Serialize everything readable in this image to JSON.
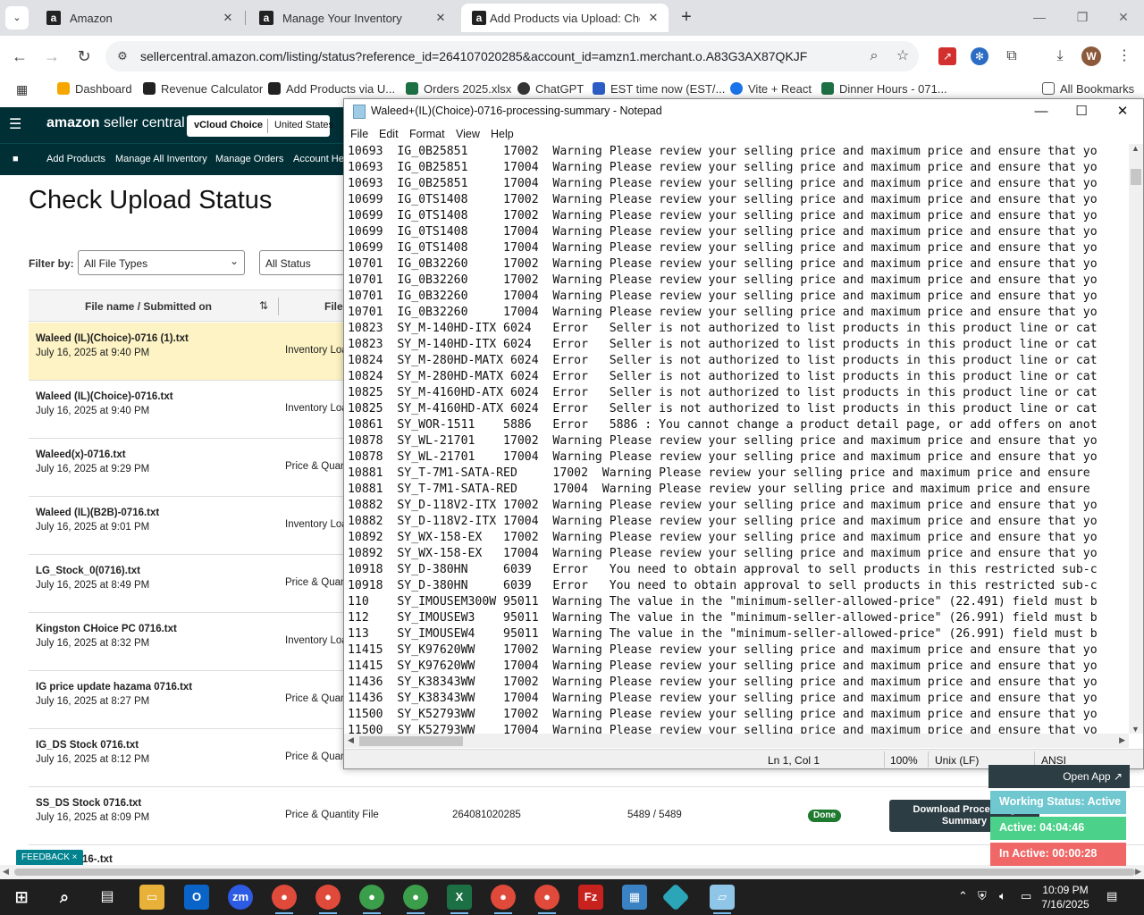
{
  "browser": {
    "tabs": [
      {
        "label": "Amazon",
        "icon": "amazon-icon"
      },
      {
        "label": "Manage Your Inventory",
        "icon": "amazon-icon"
      },
      {
        "label": "Add Products via Upload: Chec",
        "icon": "amazon-icon"
      }
    ],
    "url": "sellercentral.amazon.com/listing/status?reference_id=264107020285&account_id=amzn1.merchant.o.A83G3AX87QKJF",
    "avatar_letter": "W",
    "bookmarks": [
      {
        "label": "Dashboard",
        "color": "#f7a600"
      },
      {
        "label": "Revenue Calculator",
        "color": "#222222"
      },
      {
        "label": "Add Products via U...",
        "color": "#222222"
      },
      {
        "label": "Orders 2025.xlsx",
        "color": "#1d7044"
      },
      {
        "label": "ChatGPT",
        "color": "#333333"
      },
      {
        "label": "EST time now (EST/...",
        "color": "#2c5cc5"
      },
      {
        "label": "Vite + React",
        "color": "#1a73e8"
      },
      {
        "label": "Dinner Hours - 071...",
        "color": "#1d7044"
      }
    ],
    "all_bookmarks": "All Bookmarks"
  },
  "seller_central": {
    "logo_main": "amazon",
    "logo_sub": " seller central",
    "store_name": "vCloud Choice",
    "store_region": "United States",
    "nav": [
      "Add Products",
      "Manage All Inventory",
      "Manage Orders",
      "Account Hea"
    ],
    "title": "Check Upload Status",
    "filter_label": "Filter by:",
    "filter_type": "All File Types",
    "filter_status": "All Status",
    "col_file": "File name / Submitted on",
    "col_type": "File",
    "rows": [
      {
        "name": "Waleed (IL)(Choice)-0716 (1).txt",
        "date": "July 16, 2025 at 9:40 PM",
        "type": "Inventory Loa"
      },
      {
        "name": "Waleed (IL)(Choice)-0716.txt",
        "date": "July 16, 2025 at 9:40 PM",
        "type": "Inventory Loa"
      },
      {
        "name": "Waleed(x)-0716.txt",
        "date": "July 16, 2025 at 9:29 PM",
        "type": "Price & Quan"
      },
      {
        "name": "Waleed (IL)(B2B)-0716.txt",
        "date": "July 16, 2025 at 9:01 PM",
        "type": "Inventory Loa"
      },
      {
        "name": "LG_Stock_0(0716).txt",
        "date": "July 16, 2025 at 8:49 PM",
        "type": "Price & Quan"
      },
      {
        "name": "Kingston CHoice PC 0716.txt",
        "date": "July 16, 2025 at 8:32 PM",
        "type": "Inventory Loa"
      },
      {
        "name": "IG price update hazama 0716.txt",
        "date": "July 16, 2025 at 8:27 PM",
        "type": "Price & Quan"
      },
      {
        "name": "IG_DS Stock 0716.txt",
        "date": "July 16, 2025 at 8:12 PM",
        "type": "Price & Quan"
      },
      {
        "name": "SS_DS Stock 0716.txt",
        "date": "July 16, 2025 at 8:09 PM",
        "type": "Price & Quantity File",
        "ref": "264081020285",
        "count": "5489 / 5489",
        "status": "Done",
        "download": "Download Processing Summary"
      }
    ],
    "last_row_partial": "16-.txt",
    "feedback": "FEEDBACK ×"
  },
  "notepad": {
    "title": "Waleed+(IL)(Choice)-0716-processing-summary - Notepad",
    "menu": [
      "File",
      "Edit",
      "Format",
      "View",
      "Help"
    ],
    "lines": [
      "10693  IG_0B25851     17002  Warning Please review your selling price and maximum price and ensure that yo",
      "10693  IG_0B25851     17004  Warning Please review your selling price and maximum price and ensure that yo",
      "10693  IG_0B25851     17004  Warning Please review your selling price and maximum price and ensure that yo",
      "10699  IG_0TS1408     17002  Warning Please review your selling price and maximum price and ensure that yo",
      "10699  IG_0TS1408     17002  Warning Please review your selling price and maximum price and ensure that yo",
      "10699  IG_0TS1408     17004  Warning Please review your selling price and maximum price and ensure that yo",
      "10699  IG_0TS1408     17004  Warning Please review your selling price and maximum price and ensure that yo",
      "10701  IG_0B32260     17002  Warning Please review your selling price and maximum price and ensure that yo",
      "10701  IG_0B32260     17002  Warning Please review your selling price and maximum price and ensure that yo",
      "10701  IG_0B32260     17004  Warning Please review your selling price and maximum price and ensure that yo",
      "10701  IG_0B32260     17004  Warning Please review your selling price and maximum price and ensure that yo",
      "10823  SY_M-140HD-ITX 6024   Error   Seller is not authorized to list products in this product line or cat",
      "10823  SY_M-140HD-ITX 6024   Error   Seller is not authorized to list products in this product line or cat",
      "10824  SY_M-280HD-MATX 6024  Error   Seller is not authorized to list products in this product line or cat",
      "10824  SY_M-280HD-MATX 6024  Error   Seller is not authorized to list products in this product line or cat",
      "10825  SY_M-4160HD-ATX 6024  Error   Seller is not authorized to list products in this product line or cat",
      "10825  SY_M-4160HD-ATX 6024  Error   Seller is not authorized to list products in this product line or cat",
      "10861  SY_WOR-1511    5886   Error   5886 : You cannot change a product detail page, or add offers on anot",
      "10878  SY_WL-21701    17002  Warning Please review your selling price and maximum price and ensure that yo",
      "10878  SY_WL-21701    17004  Warning Please review your selling price and maximum price and ensure that yo",
      "10881  SY_T-7M1-SATA-RED     17002  Warning Please review your selling price and maximum price and ensure",
      "10881  SY_T-7M1-SATA-RED     17004  Warning Please review your selling price and maximum price and ensure",
      "10882  SY_D-118V2-ITX 17002  Warning Please review your selling price and maximum price and ensure that yo",
      "10882  SY_D-118V2-ITX 17004  Warning Please review your selling price and maximum price and ensure that yo",
      "10892  SY_WX-158-EX   17002  Warning Please review your selling price and maximum price and ensure that yo",
      "10892  SY_WX-158-EX   17004  Warning Please review your selling price and maximum price and ensure that yo",
      "10918  SY_D-380HN     6039   Error   You need to obtain approval to sell products in this restricted sub-c",
      "10918  SY_D-380HN     6039   Error   You need to obtain approval to sell products in this restricted sub-c",
      "110    SY_IMOUSEM300W 95011  Warning The value in the \"minimum-seller-allowed-price\" (22.491) field must b",
      "112    SY_IMOUSEW3    95011  Warning The value in the \"minimum-seller-allowed-price\" (26.991) field must b",
      "113    SY_IMOUSEW4    95011  Warning The value in the \"minimum-seller-allowed-price\" (26.991) field must b",
      "11415  SY_K97620WW    17002  Warning Please review your selling price and maximum price and ensure that yo",
      "11415  SY_K97620WW    17004  Warning Please review your selling price and maximum price and ensure that yo",
      "11436  SY_K38343WW    17002  Warning Please review your selling price and maximum price and ensure that yo",
      "11436  SY_K38343WW    17004  Warning Please review your selling price and maximum price and ensure that yo",
      "11500  SY_K52793WW    17002  Warning Please review your selling price and maximum price and ensure that yo",
      "11500  SY_K52793WW    17004  Warning Please review your selling price and maximum price and ensure that yo"
    ],
    "status": {
      "position": "Ln 1, Col 1",
      "zoom": "100%",
      "eol": "Unix (LF)",
      "encoding": "ANSI"
    }
  },
  "work_status": {
    "open_app": "Open App ↗",
    "status": "Working Status: Active",
    "active": "Active: 04:04:46",
    "inactive": "In Active: 00:00:28"
  },
  "taskbar": {
    "time": "10:09 PM",
    "date": "7/16/2025"
  }
}
